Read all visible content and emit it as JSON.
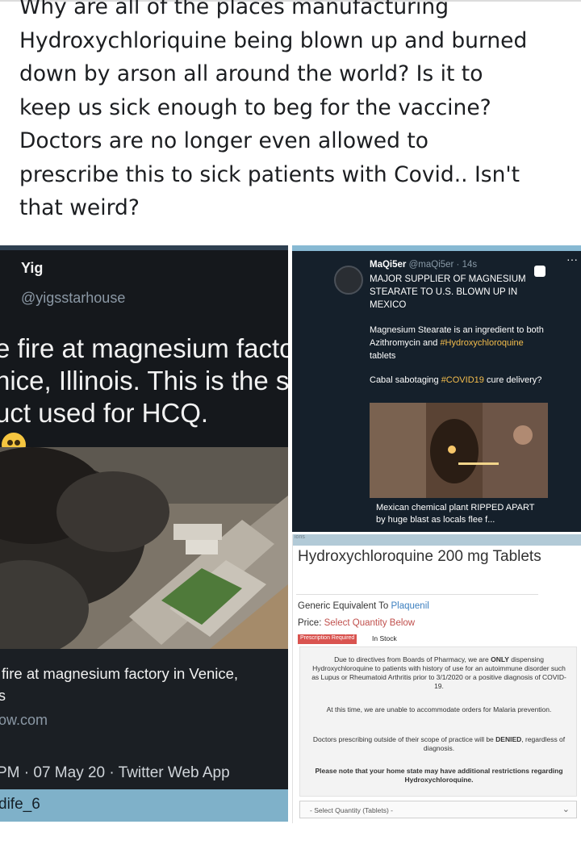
{
  "post": {
    "lines": [
      "Why are all of the places manufacturing",
      "Hydroxychloriquine being blown up and burned",
      "down by arson all around the world? Is it to",
      "keep us sick enough to beg for the vaccine?",
      "Doctors are no longer even allowed to",
      "prescribe this to sick patients with Covid.. Isn't",
      "that weird?"
    ]
  },
  "left_tweet": {
    "name": "Yig",
    "handle": "@yigsstarhouse",
    "body_lines": [
      "e fire at magnesium facto",
      "nice, Illinois. This is the sa",
      "uct used for HCQ."
    ],
    "card_title": "fire at magnesium factory in Venice,",
    "card_s": "s",
    "card_domain": "ow.com",
    "meta": "PM · 07 May 20 · Twitter Web App",
    "footer_user": "dife_6"
  },
  "right_tweet": {
    "name": "MaQi5er",
    "handle": "@maQi5er · 14s",
    "headline": "MAJOR SUPPLIER OF MAGNESIUM STEARATE TO U.S. BLOWN UP IN MEXICO",
    "para1_text": "Magnesium Stearate is an ingredient to both Azithromycin and ",
    "para1_tag": "#Hydroxychloroquine",
    "para1_tail": " tablets",
    "para2_text": "Cabal sabotaging ",
    "para2_tag": "#COVID19",
    "para2_tail": " cure delivery?",
    "caption": "Mexican chemical plant RIPPED APART by huge blast as locals flee f...",
    "dots": "···",
    "tag_color": "#f4bd4c"
  },
  "pharmacy": {
    "strip": "ions",
    "title": "Hydroxychloroquine 200 mg Tablets",
    "generic_label": "Generic Equivalent To ",
    "generic_value": "Plaquenil",
    "price_label": "Price: ",
    "price_value": "Select Quantity Below",
    "rx_badge": "Prescription Required",
    "stock": "In Stock",
    "notice_1a": "Due to directives from Boards of Pharmacy, we are ",
    "notice_1b": "ONLY",
    "notice_1c": " dispensing Hydroxychloroquine to patients with history of use for an autoimmune disorder such as Lupus or Rheumatoid Arthritis prior to 3/1/2020 or a positive diagnosis of COVID-19.",
    "notice_2": "At this time, we are unable to accommodate orders for Malaria prevention.",
    "notice_3a": "Doctors prescribing outside of their scope of practice will be ",
    "notice_3b": "DENIED",
    "notice_3c": ", regardless of diagnosis.",
    "notice_4": "Please note that your home state may have additional restrictions regarding Hydroxychloroquine.",
    "select_placeholder": "- Select Quantity (Tablets) -"
  }
}
